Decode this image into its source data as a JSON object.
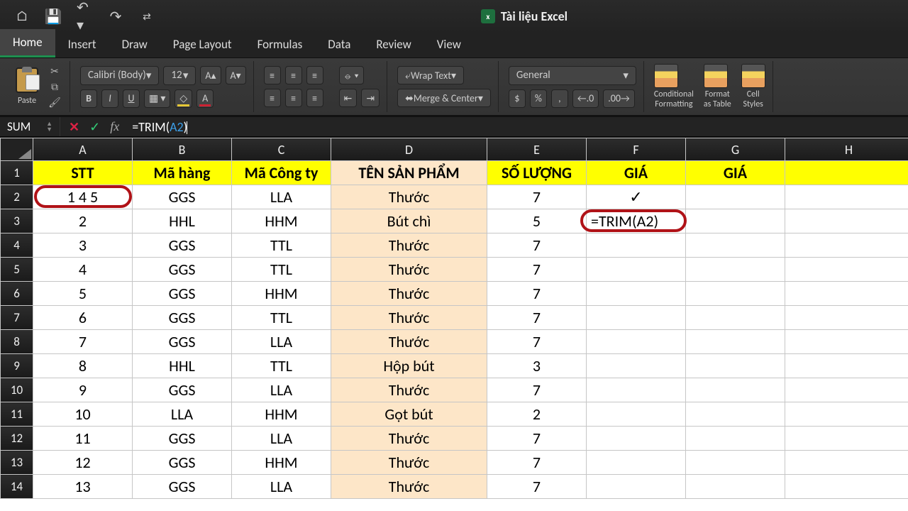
{
  "titlebar": {
    "doc_label": "Tài liệu Excel",
    "doc_icon": "x"
  },
  "tabs": [
    "Home",
    "Insert",
    "Draw",
    "Page Layout",
    "Formulas",
    "Data",
    "Review",
    "View"
  ],
  "ribbon": {
    "paste_label": "Paste",
    "font_name": "Calibri (Body)",
    "font_size": "12",
    "bold": "B",
    "italic": "I",
    "underline": "U",
    "wrap_text": "Wrap Text",
    "merge_center": "Merge & Center",
    "number_format": "General",
    "currency": "$",
    "percent": "%",
    "comma": ",",
    "dec_inc": ".0",
    "dec_dec": ".00",
    "cond_fmt": "Conditional\nFormatting",
    "fmt_table": "Format\nas Table",
    "cell_styles": "Cell\nStyles"
  },
  "formula_bar": {
    "name_box": "SUM",
    "fx": "fx",
    "prefix": "=TRIM(",
    "ref": "A2",
    "suffix": ")"
  },
  "columns": [
    "A",
    "B",
    "C",
    "D",
    "E",
    "F",
    "G",
    "H"
  ],
  "header_row": [
    "STT",
    "Mã hàng",
    "Mã Công ty",
    "TÊN SẢN PHẨM",
    "SỐ LƯỢNG",
    "GIÁ",
    "GIÁ",
    ""
  ],
  "data_rows": [
    {
      "r": "2",
      "A": "1 4 5",
      "B": "GGS",
      "C": "LLA",
      "D": "Thước",
      "E": "7",
      "F": "✓",
      "G": ""
    },
    {
      "r": "3",
      "A": "2",
      "B": "HHL",
      "C": "HHM",
      "D": "Bút chì",
      "E": "5",
      "F": "=TRIM(A2)",
      "G": ""
    },
    {
      "r": "4",
      "A": "3",
      "B": "GGS",
      "C": "TTL",
      "D": "Thước",
      "E": "7",
      "F": "",
      "G": ""
    },
    {
      "r": "5",
      "A": "4",
      "B": "GGS",
      "C": "TTL",
      "D": "Thước",
      "E": "7",
      "F": "",
      "G": ""
    },
    {
      "r": "6",
      "A": "5",
      "B": "GGS",
      "C": "HHM",
      "D": "Thước",
      "E": "7",
      "F": "",
      "G": ""
    },
    {
      "r": "7",
      "A": "6",
      "B": "GGS",
      "C": "TTL",
      "D": "Thước",
      "E": "7",
      "F": "",
      "G": ""
    },
    {
      "r": "8",
      "A": "7",
      "B": "GGS",
      "C": "LLA",
      "D": "Thước",
      "E": "7",
      "F": "",
      "G": ""
    },
    {
      "r": "9",
      "A": "8",
      "B": "HHL",
      "C": "TTL",
      "D": "Hộp bút",
      "E": "3",
      "F": "",
      "G": ""
    },
    {
      "r": "10",
      "A": "9",
      "B": "GGS",
      "C": "LLA",
      "D": "Thước",
      "E": "7",
      "F": "",
      "G": ""
    },
    {
      "r": "11",
      "A": "10",
      "B": "LLA",
      "C": "HHM",
      "D": "Gọt bút",
      "E": "2",
      "F": "",
      "G": ""
    },
    {
      "r": "12",
      "A": "11",
      "B": "GGS",
      "C": "LLA",
      "D": "Thước",
      "E": "7",
      "F": "",
      "G": ""
    },
    {
      "r": "13",
      "A": "12",
      "B": "GGS",
      "C": "HHM",
      "D": "Thước",
      "E": "7",
      "F": "",
      "G": ""
    },
    {
      "r": "14",
      "A": "13",
      "B": "GGS",
      "C": "LLA",
      "D": "Thước",
      "E": "7",
      "F": "",
      "G": ""
    }
  ],
  "chart_data": {
    "type": "table",
    "columns": [
      "STT",
      "Mã hàng",
      "Mã Công ty",
      "TÊN SẢN PHẨM",
      "SỐ LƯỢNG",
      "GIÁ",
      "GIÁ"
    ],
    "rows": [
      [
        "1 4 5",
        "GGS",
        "LLA",
        "Thước",
        7,
        "✓",
        ""
      ],
      [
        2,
        "HHL",
        "HHM",
        "Bút chì",
        5,
        "=TRIM(A2)",
        ""
      ],
      [
        3,
        "GGS",
        "TTL",
        "Thước",
        7,
        "",
        ""
      ],
      [
        4,
        "GGS",
        "TTL",
        "Thước",
        7,
        "",
        ""
      ],
      [
        5,
        "GGS",
        "HHM",
        "Thước",
        7,
        "",
        ""
      ],
      [
        6,
        "GGS",
        "TTL",
        "Thước",
        7,
        "",
        ""
      ],
      [
        7,
        "GGS",
        "LLA",
        "Thước",
        7,
        "",
        ""
      ],
      [
        8,
        "HHL",
        "TTL",
        "Hộp bút",
        3,
        "",
        ""
      ],
      [
        9,
        "GGS",
        "LLA",
        "Thước",
        7,
        "",
        ""
      ],
      [
        10,
        "LLA",
        "HHM",
        "Gọt bút",
        2,
        "",
        ""
      ],
      [
        11,
        "GGS",
        "LLA",
        "Thước",
        7,
        "",
        ""
      ],
      [
        12,
        "GGS",
        "HHM",
        "Thước",
        7,
        "",
        ""
      ],
      [
        13,
        "GGS",
        "LLA",
        "Thước",
        7,
        "",
        ""
      ]
    ]
  }
}
